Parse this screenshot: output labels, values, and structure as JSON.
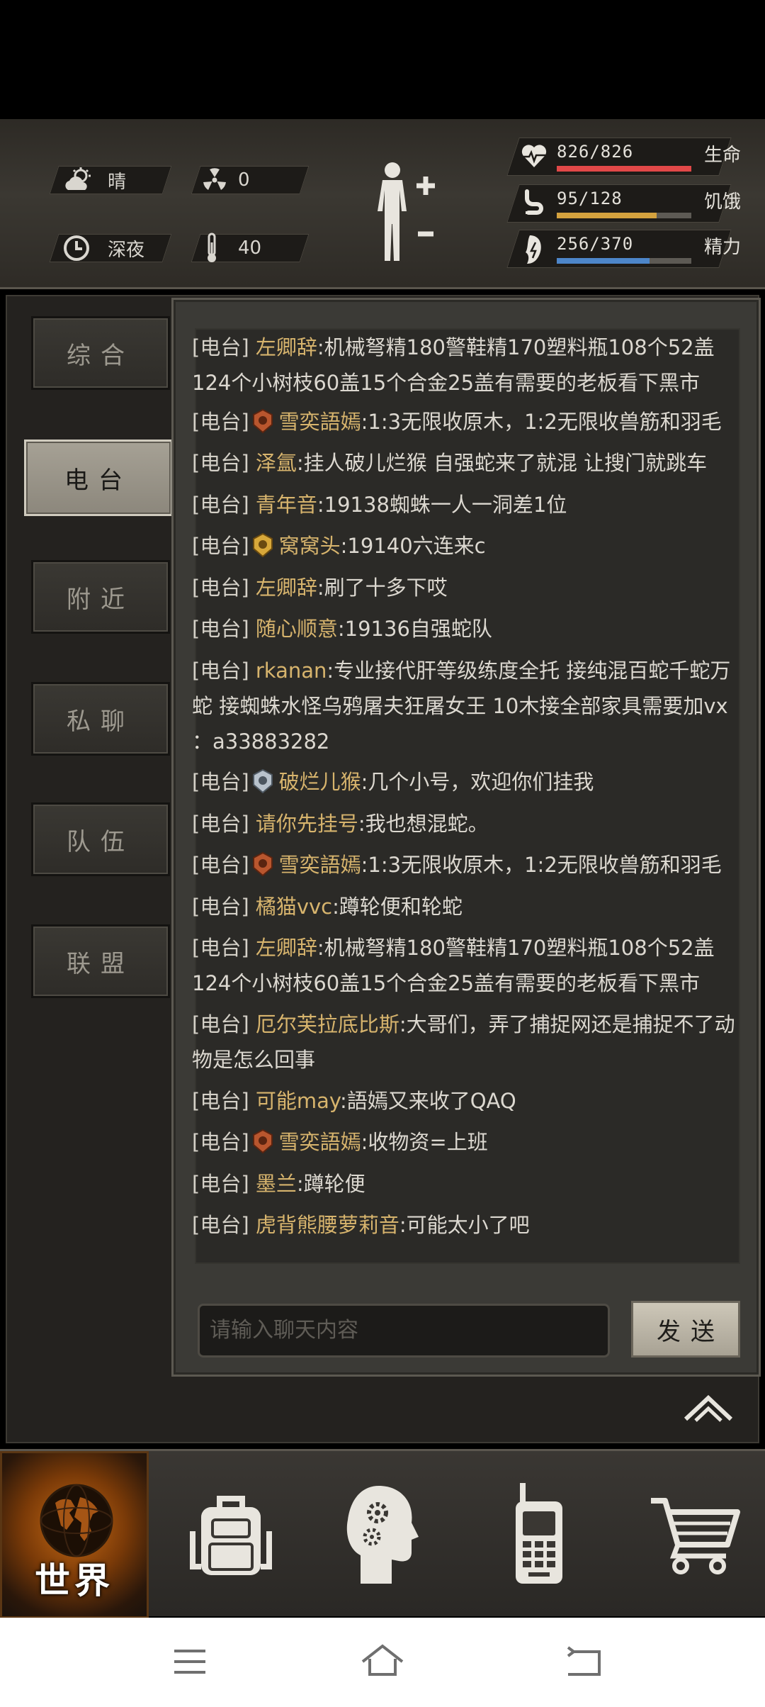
{
  "status": {
    "weather": "晴",
    "radiation": "0",
    "time_of_day": "深夜",
    "temperature": "40",
    "health": {
      "value": "826/826",
      "label": "生命",
      "fraction": 1.0,
      "color": "#e14848"
    },
    "hunger": {
      "value": "95/128",
      "label": "饥饿",
      "fraction": 0.742,
      "color": "#d4a23e"
    },
    "energy": {
      "value": "256/370",
      "label": "精力",
      "fraction": 0.692,
      "color": "#4d86c9"
    }
  },
  "tabs": [
    "综合",
    "电台",
    "附近",
    "私聊",
    "队伍",
    "联盟"
  ],
  "active_tab": "电台",
  "messages": [
    {
      "channel": "[电台]",
      "name": "左卿辞",
      "text": ":机械弩精180警鞋精170塑料瓶108个52盖124个小树枝60盖15个合金25盖有需要的老板看下黑市"
    },
    {
      "channel": "[电台]",
      "name": "雪奕語嫣",
      "text": ":1:3无限收原木，1:2无限收兽筋和羽毛",
      "badge": "red"
    },
    {
      "channel": "[电台]",
      "name": "泽氲",
      "text": ":挂人破儿烂猴 自强蛇来了就混 让搜门就跳车"
    },
    {
      "channel": "[电台]",
      "name": "青年音",
      "text": ":19138蜘蛛一人一洞差1位"
    },
    {
      "channel": "[电台]",
      "name": "窝窝头",
      "text": ":19140六连来c",
      "badge": "gold"
    },
    {
      "channel": "[电台]",
      "name": "左卿辞",
      "text": ":刷了十多下哎"
    },
    {
      "channel": "[电台]",
      "name": "随心顺意",
      "text": ":19136自强蛇队"
    },
    {
      "channel": "[电台]",
      "name": "rkanan",
      "text": ":专业接代肝等级练度全托 接纯混百蛇千蛇万蛇 接蜘蛛水怪乌鸦屠夫狂屠女王 10木接全部家具需要加vx ：a33883282"
    },
    {
      "channel": "[电台]",
      "name": "破烂儿猴",
      "text": ":几个小号，欢迎你们挂我",
      "badge": "silver"
    },
    {
      "channel": "[电台]",
      "name": "请你先挂号",
      "text": ":我也想混蛇。"
    },
    {
      "channel": "[电台]",
      "name": "雪奕語嫣",
      "text": ":1:3无限收原木，1:2无限收兽筋和羽毛",
      "badge": "red"
    },
    {
      "channel": "[电台]",
      "name": "橘猫vvc",
      "text": ":蹲轮便和轮蛇"
    },
    {
      "channel": "[电台]",
      "name": "左卿辞",
      "text": ":机械弩精180警鞋精170塑料瓶108个52盖124个小树枝60盖15个合金25盖有需要的老板看下黑市"
    },
    {
      "channel": "[电台]",
      "name": "厄尔芙拉底比斯",
      "text": ":大哥们，弄了捕捉网还是捕捉不了动物是怎么回事"
    },
    {
      "channel": "[电台]",
      "name": "可能may",
      "text": ":語嫣又来收了QAQ"
    },
    {
      "channel": "[电台]",
      "name": "雪奕語嫣",
      "text": ":收物资=上班",
      "badge": "red"
    },
    {
      "channel": "[电台]",
      "name": "墨兰",
      "text": ":蹲轮便"
    },
    {
      "channel": "[电台]",
      "name": "虎背熊腰萝莉音",
      "text": ":可能太小了吧"
    }
  ],
  "input": {
    "placeholder": "请输入聊天内容"
  },
  "send_label": "发送",
  "nav": {
    "world_label": "世界"
  },
  "icons": {
    "weather": "cloud-sun-icon",
    "radiation": "radiation-icon",
    "clock": "clock-icon",
    "thermometer": "thermometer-icon",
    "body": "body-figure-icon",
    "heart": "heart-icon",
    "stomach": "stomach-icon",
    "energy": "energy-icon",
    "backpack": "backpack-icon",
    "skills": "head-gears-icon",
    "radio": "walkie-talkie-icon",
    "shop": "cart-icon"
  }
}
